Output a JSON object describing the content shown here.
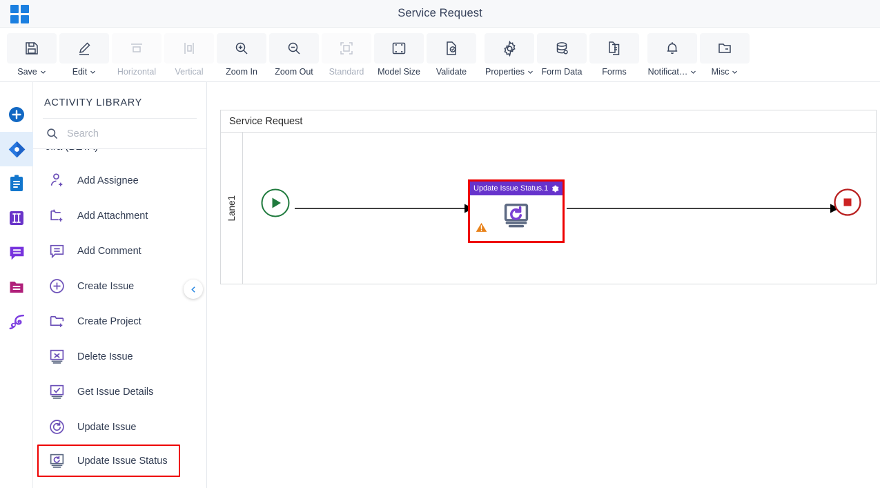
{
  "window": {
    "title": "Service Request",
    "apps_icon": "apps-grid-icon"
  },
  "toolbar": {
    "items": [
      {
        "id": "save",
        "label": "Save",
        "icon": "save-floppy-icon",
        "dropdown": true,
        "disabled": false
      },
      {
        "id": "edit",
        "label": "Edit",
        "icon": "pencil-edit-icon",
        "dropdown": true,
        "disabled": false
      },
      {
        "id": "horizontal",
        "label": "Horizontal",
        "icon": "horizontal-align-icon",
        "dropdown": false,
        "disabled": true
      },
      {
        "id": "vertical",
        "label": "Vertical",
        "icon": "vertical-align-icon",
        "dropdown": false,
        "disabled": true
      },
      {
        "id": "zoom-in",
        "label": "Zoom In",
        "icon": "zoom-in-icon",
        "dropdown": false,
        "disabled": false
      },
      {
        "id": "zoom-out",
        "label": "Zoom Out",
        "icon": "zoom-out-icon",
        "dropdown": false,
        "disabled": false
      },
      {
        "id": "standard",
        "label": "Standard",
        "icon": "standard-fit-icon",
        "dropdown": false,
        "disabled": true
      },
      {
        "id": "model-size",
        "label": "Model Size",
        "icon": "model-size-icon",
        "dropdown": false,
        "disabled": false
      },
      {
        "id": "validate",
        "label": "Validate",
        "icon": "validate-check-icon",
        "dropdown": false,
        "disabled": false
      },
      {
        "id": "properties",
        "label": "Properties",
        "icon": "gear-icon",
        "dropdown": true,
        "disabled": false
      },
      {
        "id": "form-data",
        "label": "Form Data",
        "icon": "database-icon",
        "dropdown": false,
        "disabled": false
      },
      {
        "id": "forms",
        "label": "Forms",
        "icon": "documents-icon",
        "dropdown": false,
        "disabled": false
      },
      {
        "id": "notification",
        "label": "Notificat…",
        "icon": "bell-icon",
        "dropdown": true,
        "disabled": false
      },
      {
        "id": "misc",
        "label": "Misc",
        "icon": "folder-misc-icon",
        "dropdown": true,
        "disabled": false
      }
    ]
  },
  "rail": {
    "items": [
      {
        "id": "add",
        "icon": "plus-circle-icon",
        "color": "#1268c3",
        "active": false
      },
      {
        "id": "jira",
        "icon": "jira-diamond-icon",
        "color": "#2878e0",
        "active": true
      },
      {
        "id": "tasks",
        "icon": "clipboard-icon",
        "color": "#1276cd",
        "active": false
      },
      {
        "id": "columns",
        "icon": "columns-icon",
        "color": "#6a34c9",
        "active": false
      },
      {
        "id": "comments",
        "icon": "speech-bubble-icon",
        "color": "#7733dd",
        "active": false
      },
      {
        "id": "documents",
        "icon": "folder-lines-icon",
        "color": "#b01f7a",
        "active": false
      },
      {
        "id": "automation",
        "icon": "swirl-icon",
        "color": "#7d3fe0",
        "active": false
      }
    ]
  },
  "panel": {
    "title": "ACTIVITY LIBRARY",
    "search": {
      "placeholder": "Search",
      "value": "",
      "icon": "search-icon"
    },
    "group": {
      "label": "Jira (BETA)",
      "collapse_icon": "chevron-up-icon",
      "expanded": true
    },
    "collapse_button": {
      "icon": "chevron-left-icon"
    },
    "activities": [
      {
        "id": "add-assignee",
        "label": "Add Assignee",
        "icon": "person-add-icon",
        "highlighted": false
      },
      {
        "id": "add-attachment",
        "label": "Add Attachment",
        "icon": "attachment-add-icon",
        "highlighted": false
      },
      {
        "id": "add-comment",
        "label": "Add Comment",
        "icon": "comment-add-icon",
        "highlighted": false
      },
      {
        "id": "create-issue",
        "label": "Create Issue",
        "icon": "plus-circle-icon",
        "highlighted": false
      },
      {
        "id": "create-project",
        "label": "Create Project",
        "icon": "folder-add-icon",
        "highlighted": false
      },
      {
        "id": "delete-issue",
        "label": "Delete Issue",
        "icon": "monitor-x-icon",
        "highlighted": false
      },
      {
        "id": "get-issue-details",
        "label": "Get Issue Details",
        "icon": "monitor-check-icon",
        "highlighted": false
      },
      {
        "id": "update-issue",
        "label": "Update Issue",
        "icon": "refresh-circle-icon",
        "highlighted": false
      },
      {
        "id": "update-issue-status",
        "label": "Update Issue Status",
        "icon": "monitor-refresh-icon",
        "highlighted": true
      }
    ]
  },
  "diagram": {
    "pool_name": "Service Request",
    "lane_name": "Lane1",
    "start_event": {
      "id": "start",
      "icon": "start-play-icon",
      "color": "#1f7a3d"
    },
    "end_event": {
      "id": "end",
      "icon": "end-stop-icon",
      "color": "#b92020"
    },
    "task": {
      "name": "Update Issue Status.1",
      "header_color": "#6633cc",
      "selection_color": "#ee0000",
      "gear_icon": "gear-icon",
      "warning_icon": "warning-triangle-icon",
      "body_icon": "monitor-refresh-icon"
    }
  },
  "colors": {
    "accent_blue": "#1a7fe0",
    "purple": "#6633cc",
    "selection_red": "#ee0000",
    "warning_orange": "#e8821a"
  }
}
